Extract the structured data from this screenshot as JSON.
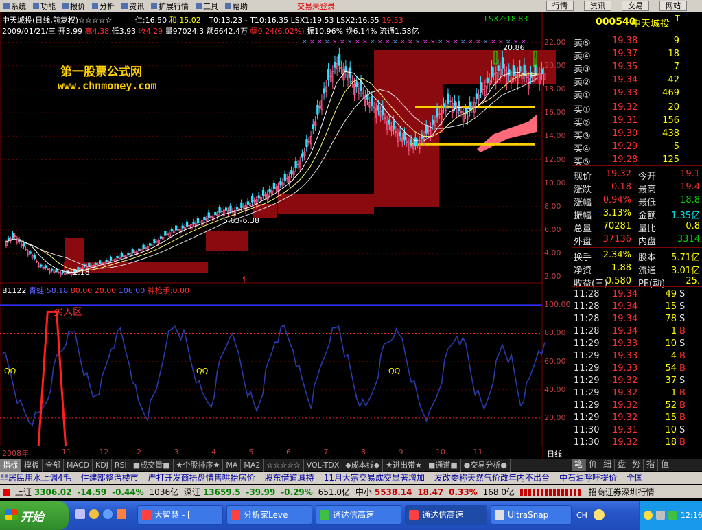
{
  "menu": {
    "items": [
      "系统",
      "功能",
      "报价",
      "分析",
      "资讯",
      "扩展行情",
      "工具",
      "帮助"
    ],
    "status": "交易未登录",
    "right_buttons": [
      "行情",
      "资讯",
      "交易",
      "网站"
    ]
  },
  "chart": {
    "title": "中天城投(日线,前复权)☆☆☆☆☆",
    "header_values": [
      "仁:16.50",
      "和:15.02",
      "T0:13.23",
      "-",
      "T10:16.35",
      "LSX1:19.53",
      "LSX2:16.55"
    ],
    "header_red": "19.53",
    "header_lsxz": "LSXZ:18.83",
    "info2": {
      "date": "2009/01/21/三",
      "open": "开3.99",
      "high": "高4.38",
      "low": "低3.93",
      "close": "收4.29",
      "vol": "量97024.3",
      "amount": "额6642.4万",
      "chg": "幅0.24(6.02%)",
      "amp": "振10.96%",
      "turn": "换6.14%",
      "float": "流通1.58亿"
    },
    "watermark1": "第一股票公式网",
    "watermark2": "www.chnmoney.com",
    "annotations": [
      "20.86",
      "←2.18",
      "5.63-6.38",
      "$"
    ],
    "price_axis": [
      "22.00",
      "20.00",
      "18.00",
      "16.00",
      "14.00",
      "12.00",
      "10.00",
      "8.00",
      "6.00",
      "4.00",
      "2.00"
    ],
    "osc_axis": [
      "100.00",
      "80.00",
      "60.00",
      "40.00",
      "20.00"
    ],
    "osc_label": "B1122",
    "osc_values": [
      "青蛙:58.18",
      "80.00",
      "20.00",
      "106.00",
      "神枪手:0.00"
    ],
    "osc_zone_label": "买入区",
    "qq_label": "QQ",
    "time_axis": [
      "2008年",
      "11",
      "12",
      "2",
      "3",
      "4",
      "5",
      "6",
      "7",
      "8",
      "9",
      "10",
      "11"
    ],
    "period": "日线"
  },
  "chart_data": [
    {
      "type": "candlestick",
      "title": "中天城投(日线,前复权)",
      "y_ticks": [
        2,
        4,
        6,
        8,
        10,
        12,
        14,
        16,
        18,
        20,
        22
      ],
      "ylim": [
        1.5,
        22.5
      ],
      "x_ticks": [
        "2008年",
        "11",
        "12",
        "2",
        "3",
        "4",
        "5",
        "6",
        "7",
        "8",
        "9",
        "10",
        "11"
      ],
      "close_path": [
        5.0,
        5.5,
        4.6,
        3.8,
        2.9,
        2.6,
        2.4,
        2.3,
        2.5,
        2.9,
        3.0,
        3.2,
        3.4,
        3.7,
        3.9,
        4.2,
        4.5,
        4.9,
        5.4,
        5.9,
        6.1,
        6.4,
        6.6,
        7.0,
        7.3,
        7.7,
        7.6,
        7.9,
        8.3,
        8.7,
        9.1,
        9.6,
        10.2,
        11.0,
        12.2,
        14.0,
        16.5,
        18.8,
        20.2,
        19.5,
        18.4,
        17.7,
        16.6,
        16.1,
        15.0,
        14.2,
        13.5,
        13.2,
        14.0,
        15.0,
        16.2,
        17.0,
        16.2,
        15.8,
        17.2,
        18.3,
        19.3,
        19.8,
        19.0,
        19.5,
        18.9,
        19.3
      ]
    },
    {
      "type": "line",
      "title": "B1122",
      "ylim": [
        0,
        106
      ],
      "y_ticks": [
        20,
        40,
        60,
        80,
        100
      ],
      "series": [
        {
          "name": "青蛙",
          "values": [
            70,
            50,
            28,
            18,
            20,
            35,
            62,
            75,
            80,
            55,
            35,
            45,
            70,
            80,
            60,
            30,
            22,
            40,
            75,
            85,
            78,
            55,
            35,
            30,
            60,
            80,
            65,
            40,
            25,
            50,
            75,
            82,
            70,
            45,
            30,
            55,
            78,
            85,
            60,
            35,
            25,
            45,
            70,
            80,
            75,
            50,
            28,
            20,
            40,
            65,
            80,
            70,
            40,
            25,
            50,
            72,
            60,
            30,
            45,
            70
          ]
        },
        {
          "name": "神枪手",
          "values": [
            0,
            0,
            0,
            0,
            0,
            100,
            100,
            0,
            0,
            0,
            0,
            0,
            0,
            0,
            0,
            0,
            0,
            0,
            0,
            0,
            0,
            0,
            0,
            0,
            0,
            0,
            0,
            0,
            0,
            0,
            0,
            0,
            0,
            0,
            0,
            0,
            0,
            0,
            0,
            0,
            0,
            0,
            0,
            0,
            0,
            0,
            0,
            0,
            0,
            0,
            0,
            0,
            0,
            0,
            0,
            0,
            0,
            0,
            0,
            0
          ]
        }
      ]
    }
  ],
  "quote": {
    "code": "000540",
    "name": "中天城投",
    "flag": "T",
    "asks": [
      {
        "label": "卖⑤",
        "price": "19.38",
        "vol": "9"
      },
      {
        "label": "卖④",
        "price": "19.37",
        "vol": "18"
      },
      {
        "label": "卖③",
        "price": "19.35",
        "vol": "7"
      },
      {
        "label": "卖②",
        "price": "19.34",
        "vol": "42"
      },
      {
        "label": "卖①",
        "price": "19.33",
        "vol": "469"
      }
    ],
    "bids": [
      {
        "label": "买①",
        "price": "19.32",
        "vol": "20"
      },
      {
        "label": "买②",
        "price": "19.31",
        "vol": "156"
      },
      {
        "label": "买③",
        "price": "19.30",
        "vol": "438"
      },
      {
        "label": "买④",
        "price": "19.29",
        "vol": "5"
      },
      {
        "label": "买⑤",
        "price": "19.28",
        "vol": "125"
      }
    ],
    "stats": [
      {
        "l1": "现价",
        "v1": "19.32",
        "l2": "今开",
        "v2": "19.1",
        "c1": "#ff3030",
        "c2": "#ff3030"
      },
      {
        "l1": "涨跌",
        "v1": "0.18",
        "l2": "最高",
        "v2": "19.4",
        "c1": "#ff3030",
        "c2": "#ff3030"
      },
      {
        "l1": "涨幅",
        "v1": "0.94%",
        "l2": "最低",
        "v2": "18.8",
        "c1": "#ff3030",
        "c2": "#00d000"
      },
      {
        "l1": "振幅",
        "v1": "3.13%",
        "l2": "金额",
        "v2": "1.35亿",
        "c1": "#ffff00",
        "c2": "#00e0e0"
      },
      {
        "l1": "总量",
        "v1": "70281",
        "l2": "量比",
        "v2": "0.8",
        "c1": "#ffff00",
        "c2": "#ffff00"
      },
      {
        "l1": "外盘",
        "v1": "37136",
        "l2": "内盘",
        "v2": "3314",
        "c1": "#ff3030",
        "c2": "#00d000"
      },
      {
        "l1": "换手",
        "v1": "2.34%",
        "l2": "股本",
        "v2": "5.71亿",
        "c1": "#ffff00",
        "c2": "#ffff00"
      },
      {
        "l1": "净资",
        "v1": "1.88",
        "l2": "流通",
        "v2": "3.01亿",
        "c1": "#ffff00",
        "c2": "#ffff00"
      },
      {
        "l1": "收益(三)",
        "v1": "0.580",
        "l2": "PE(动)",
        "v2": "25.",
        "c1": "#ffff00",
        "c2": "#ffff00"
      }
    ],
    "ticks": [
      {
        "time": "11:28",
        "price": "19.34",
        "vol": "49",
        "bs": "S"
      },
      {
        "time": "11:28",
        "price": "19.34",
        "vol": "15",
        "bs": "S"
      },
      {
        "time": "11:28",
        "price": "19.34",
        "vol": "78",
        "bs": "S"
      },
      {
        "time": "11:28",
        "price": "19.34",
        "vol": "1",
        "bs": "B"
      },
      {
        "time": "11:29",
        "price": "19.33",
        "vol": "10",
        "bs": "S"
      },
      {
        "time": "11:29",
        "price": "19.33",
        "vol": "4",
        "bs": "B"
      },
      {
        "time": "11:29",
        "price": "19.33",
        "vol": "54",
        "bs": "B"
      },
      {
        "time": "11:29",
        "price": "19.32",
        "vol": "37",
        "bs": "S"
      },
      {
        "time": "11:29",
        "price": "19.32",
        "vol": "1",
        "bs": "B"
      },
      {
        "time": "11:29",
        "price": "19.32",
        "vol": "52",
        "bs": "B"
      },
      {
        "time": "11:29",
        "price": "19.32",
        "vol": "15",
        "bs": "B"
      },
      {
        "time": "11:30",
        "price": "19.31",
        "vol": "10",
        "bs": "S"
      },
      {
        "time": "11:30",
        "price": "19.32",
        "vol": "18",
        "bs": "B"
      }
    ]
  },
  "tabs": [
    "指标",
    "模板",
    "全部",
    "MACD",
    "KDJ",
    "RSI",
    "■成交量■",
    "★个股排序★",
    "MA",
    "MA2",
    "☆☆☆☆☆",
    "VOL-TDX",
    "◆成本线◆",
    "★进出带★",
    "■通道■",
    "●交易分析●"
  ],
  "right_tabs": [
    "笔",
    "价",
    "细",
    "盘",
    "势",
    "指",
    "值"
  ],
  "news": [
    "非居民用水上调4毛",
    "住建部整治楼市",
    "严打开发商捂盘惜售哄抬房价",
    "股东借道减持",
    "11月大宗交易成交显著增加",
    "发改委称天然气价改年内不出台",
    "中石油呼吁提价",
    "全国"
  ],
  "indexbar": {
    "sh_label": "上证",
    "sh_val": "3306.02",
    "sh_chg": "-14.59",
    "sh_pct": "-0.44%",
    "sh_amt": "1036亿",
    "sz_label": "深证",
    "sz_val": "13659.5",
    "sz_chg": "-39.99",
    "sz_pct": "-0.29%",
    "sz_amt": "651.0亿",
    "zx_label": "中小",
    "zx_val": "5538.14",
    "zx_chg": "18.47",
    "zx_pct": "0.33%",
    "zx_amt": "168.0亿",
    "broker": "招商证券深圳行情"
  },
  "taskbar": {
    "start": "开始",
    "tasks": [
      "大智慧 - [",
      "分析家Leve",
      "通达信高速",
      "通达信高速",
      "UltraSnap"
    ],
    "lang": "CH",
    "clock": "12:16"
  }
}
